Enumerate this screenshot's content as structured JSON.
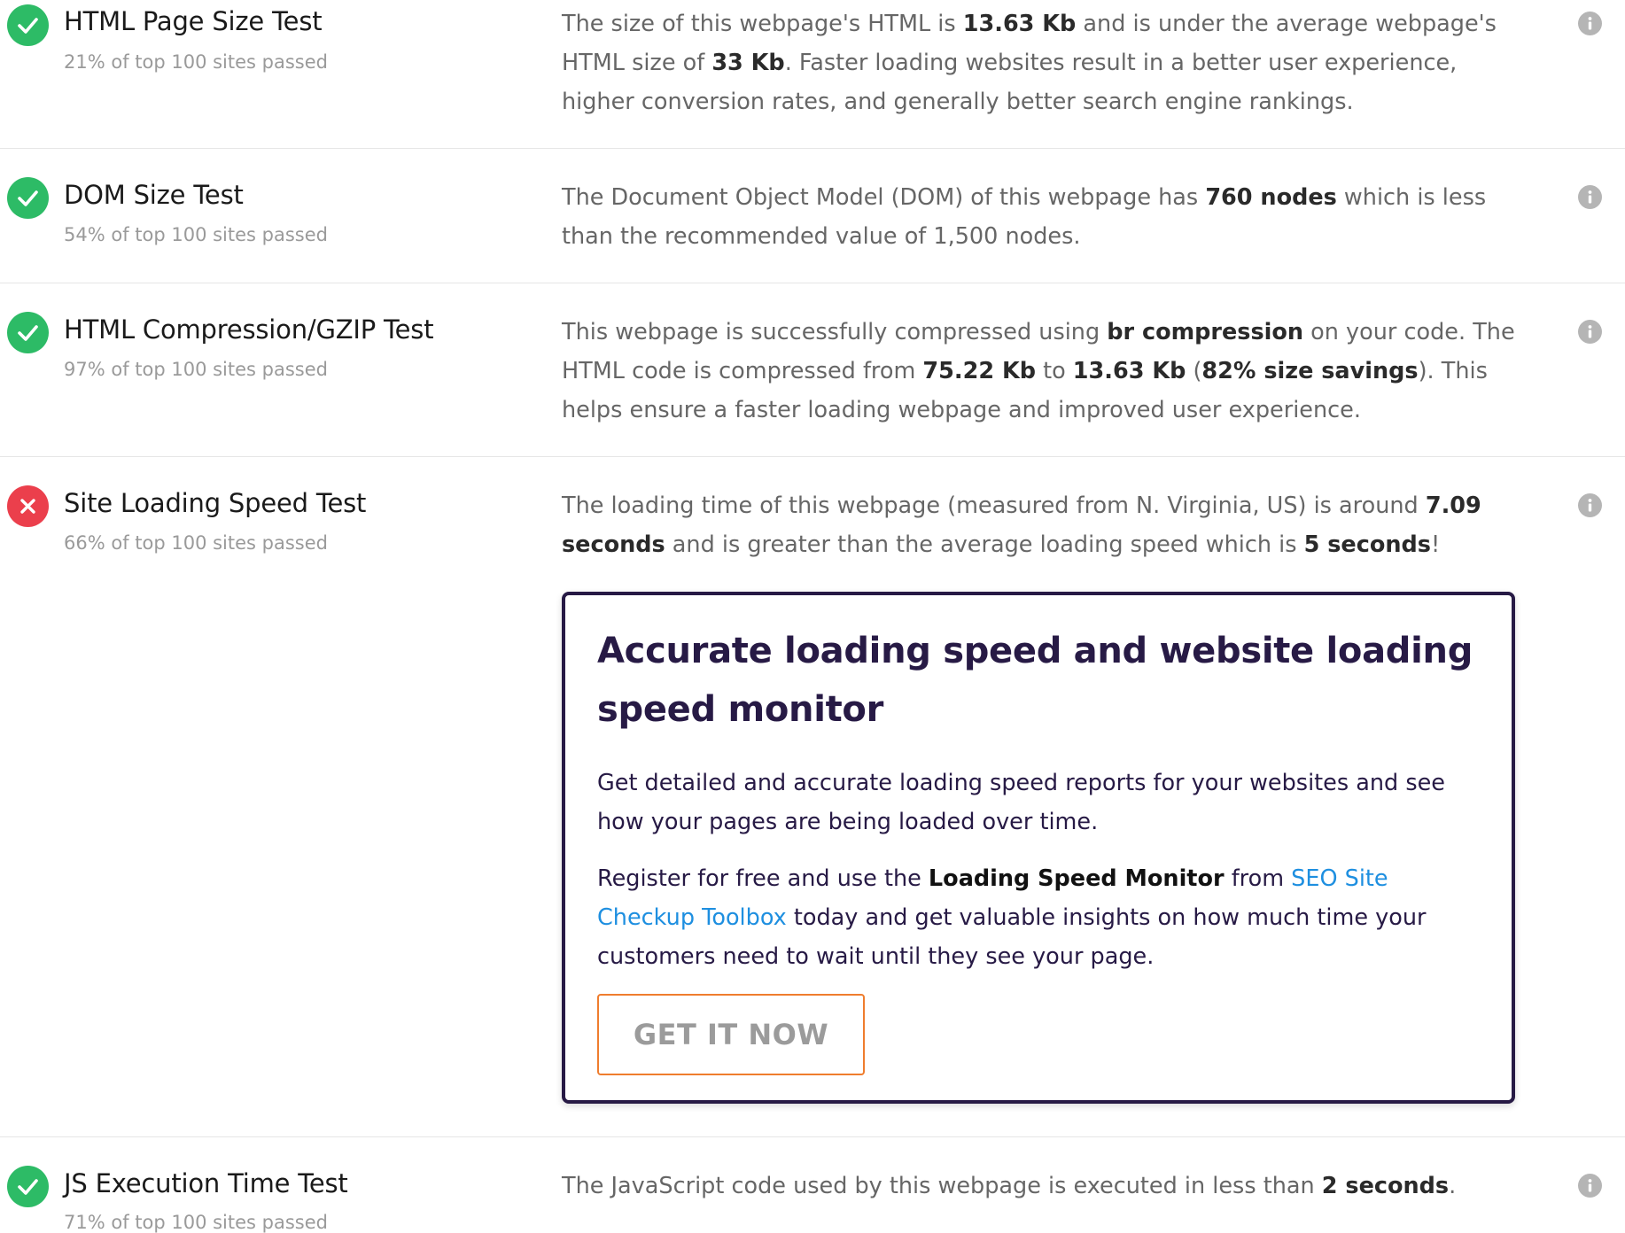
{
  "tests": [
    {
      "title": "HTML Page Size Test",
      "stat": "21% of top 100 sites passed",
      "status": "pass",
      "desc": [
        "The size of this webpage's HTML is ",
        "13.63 Kb",
        " and is under the average webpage's HTML size of ",
        "33 Kb",
        ". Faster loading websites result in a better user experience, higher conversion rates, and generally better search engine rankings."
      ]
    },
    {
      "title": "DOM Size Test",
      "stat": "54% of top 100 sites passed",
      "status": "pass",
      "desc": [
        "The Document Object Model (DOM) of this webpage has ",
        "760 nodes",
        " which is less than the recommended value of 1,500 nodes."
      ]
    },
    {
      "title": "HTML Compression/GZIP Test",
      "stat": "97% of top 100 sites passed",
      "status": "pass",
      "desc": [
        "This webpage is successfully compressed using ",
        "br compression",
        " on your code. The HTML code is compressed from ",
        "75.22 Kb",
        " to ",
        "13.63 Kb",
        " (",
        "82% size savings",
        "). This helps ensure a faster loading webpage and improved user experience."
      ]
    },
    {
      "title": "Site Loading Speed Test",
      "stat": "66% of top 100 sites passed",
      "status": "fail",
      "desc": [
        "The loading time of this webpage (measured from N. Virginia, US) is around ",
        "7.09 seconds",
        " and is greater than the average loading speed which is ",
        "5 seconds",
        "!"
      ]
    },
    {
      "title": "JS Execution Time Test",
      "stat": "71% of top 100 sites passed",
      "status": "pass",
      "desc": [
        "The JavaScript code used by this webpage is executed in less than ",
        "2 seconds",
        "."
      ]
    }
  ],
  "promo": {
    "title": "Accurate loading speed and website loading speed monitor",
    "p1": "Get detailed and accurate loading speed reports for your websites and see how your pages are being loaded over time.",
    "p2_a": "Register for free and use the ",
    "p2_b": "Loading Speed Monitor",
    "p2_c": " from ",
    "p2_link": "SEO Site Checkup Toolbox",
    "p2_d": " today and get valuable insights on how much time your customers need to wait until they see your page.",
    "cta_label": "GET IT NOW"
  },
  "colors": {
    "pass": "#2dbb66",
    "fail": "#eb3f4c",
    "promo_border": "#271a45",
    "link": "#1e8fe0",
    "cta_border": "#ef7d2e"
  },
  "icons": {
    "pass": "check-icon",
    "fail": "cross-icon",
    "info": "info-icon"
  }
}
